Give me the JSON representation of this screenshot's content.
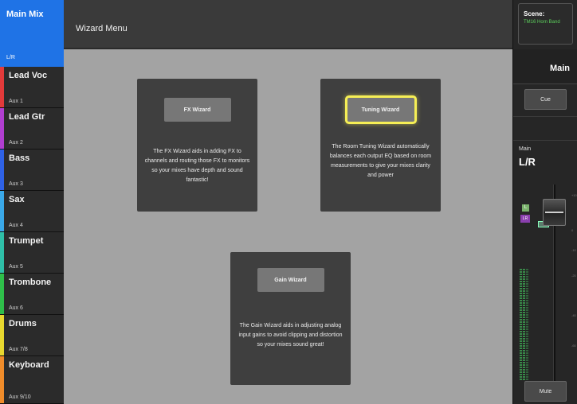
{
  "main_mix": {
    "label": "Main Mix",
    "sub": "L/R"
  },
  "mixes": [
    {
      "name": "Lead Voc",
      "sub": "Aux 1",
      "color": "#e23a3a"
    },
    {
      "name": "Lead Gtr",
      "sub": "Aux 2",
      "color": "#b03ed0"
    },
    {
      "name": "Bass",
      "sub": "Aux 3",
      "color": "#2f62e6"
    },
    {
      "name": "Sax",
      "sub": "Aux 4",
      "color": "#3aa8e8"
    },
    {
      "name": "Trumpet",
      "sub": "Aux 5",
      "color": "#2fbfa8"
    },
    {
      "name": "Trombone",
      "sub": "Aux 6",
      "color": "#2fbf4a"
    },
    {
      "name": "Drums",
      "sub": "Aux 7/8",
      "color": "#e8d82f"
    },
    {
      "name": "Keyboard",
      "sub": "Aux 9/10",
      "color": "#f08c2a"
    }
  ],
  "header": {
    "title": "Wizard Menu"
  },
  "wizards": {
    "fx": {
      "button": "FX Wizard",
      "description": "The FX Wizard aids in adding FX to channels and routing those FX to monitors so your mixes have depth and sound fantastic!"
    },
    "tuning": {
      "button": "Tuning Wizard",
      "description": "The Room Tuning Wizard automatically balances each output EQ based on room measurements to give your mixes clarity and power"
    },
    "gain": {
      "button": "Gain Wizard",
      "description": "The Gain Wizard aids in adjusting analog input gains to avoid clipping and distortion so your mixes sound great!"
    }
  },
  "right_panel": {
    "scene_label": "Scene:",
    "scene_value": "TM16 Horn Band",
    "title": "Main",
    "cue_button": "Cue",
    "channel_label": "Main",
    "channel_value": "L/R",
    "l_badge": "L",
    "lr_badge": "LR",
    "mute_button": "Mute"
  },
  "colors": {
    "accent": "#1f73e6",
    "highlight": "#f6ef55",
    "scene_text": "#5cd05c"
  }
}
